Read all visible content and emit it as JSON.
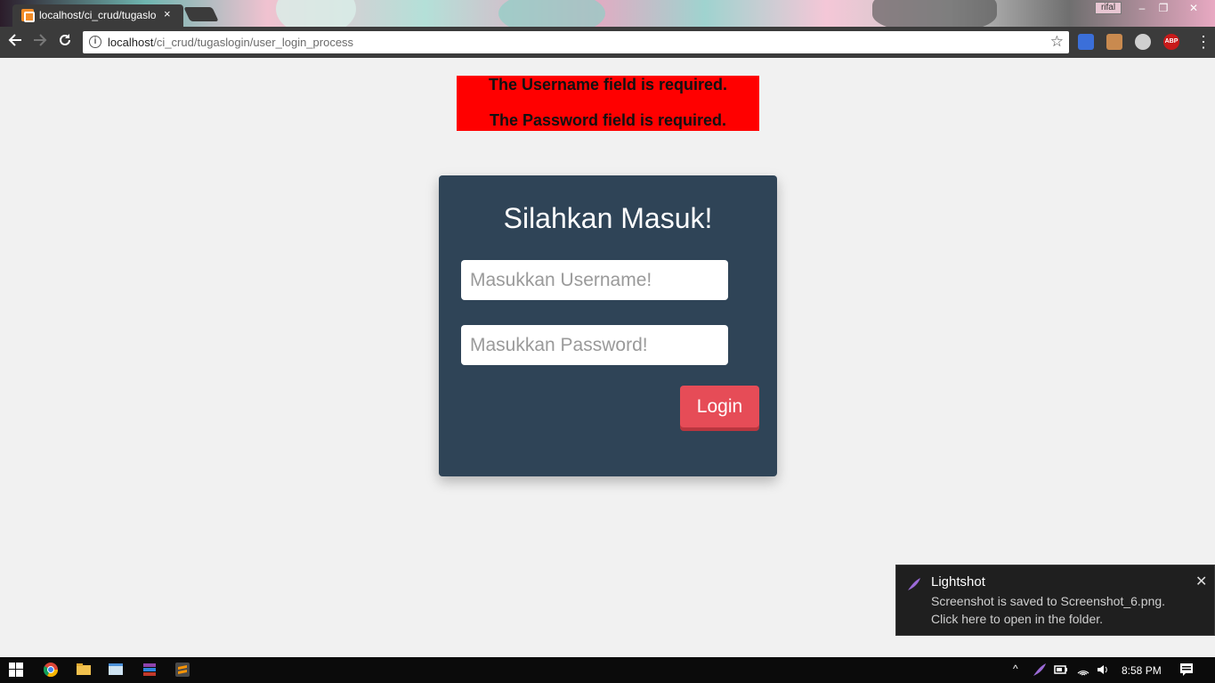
{
  "browser": {
    "tab_title": "localhost/ci_crud/tugaslo",
    "tab_close": "×",
    "user_badge": "rifal",
    "window_controls": [
      "–",
      "❐",
      "✕"
    ],
    "url_host": "localhost",
    "url_path": "/ci_crud/tugaslogin/user_login_process",
    "info_icon": "i",
    "star": "☆",
    "menu": "⋮"
  },
  "errors": [
    "The Username field is required.",
    "The Password field is required."
  ],
  "login": {
    "title": "Silahkan Masuk!",
    "username_placeholder": "Masukkan Username!",
    "password_placeholder": "Masukkan Password!",
    "button_label": "Login"
  },
  "notification": {
    "title": "Lightshot",
    "line1": "Screenshot is saved to Screenshot_6.png.",
    "line2": "Click here to open in the folder.",
    "close": "✕"
  },
  "taskbar": {
    "time": "8:58 PM",
    "tray_up": "^"
  },
  "colors": {
    "card": "#2f4457",
    "button": "#e64c57",
    "error": "#ff0000",
    "page_bg": "#f1f1f1"
  }
}
